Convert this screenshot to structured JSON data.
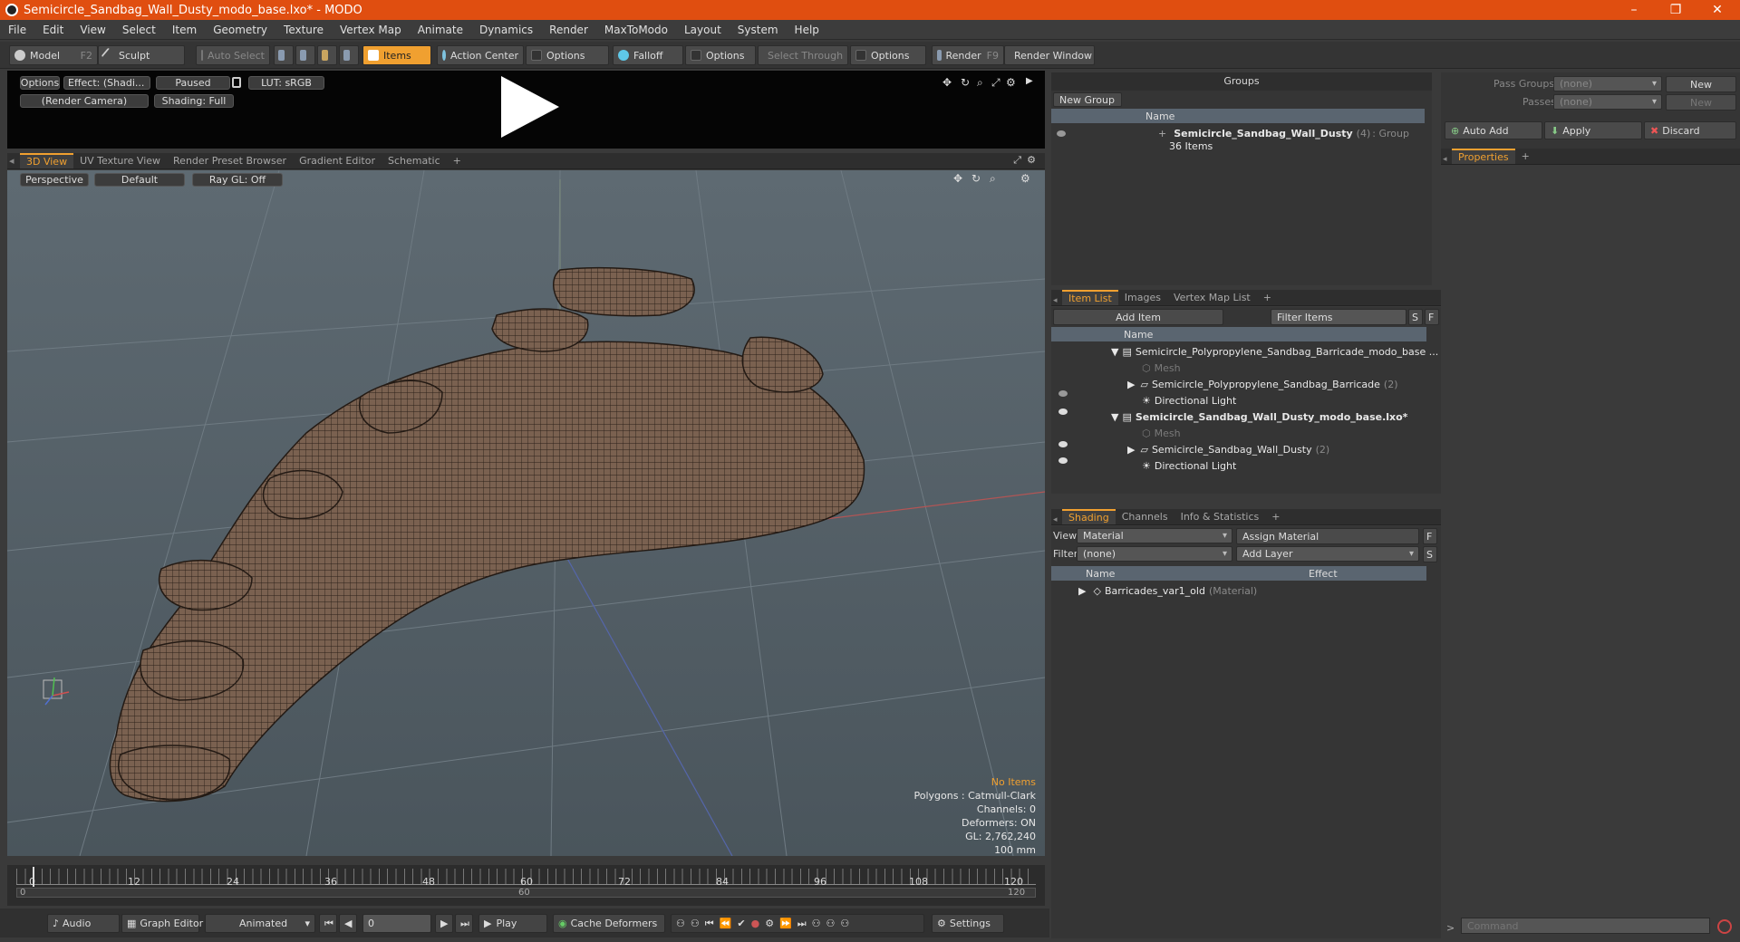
{
  "window": {
    "title": "Semicircle_Sandbag_Wall_Dusty_modo_base.lxo* - MODO",
    "minimize": "–",
    "maximize": "❐",
    "close": "✕"
  },
  "menu": [
    "File",
    "Edit",
    "View",
    "Select",
    "Item",
    "Geometry",
    "Texture",
    "Vertex Map",
    "Animate",
    "Dynamics",
    "Render",
    "MaxToModo",
    "Layout",
    "System",
    "Help"
  ],
  "toolbar": {
    "model": "Model",
    "model_key": "F2",
    "sculpt": "Sculpt",
    "auto_select": "Auto Select",
    "items": "Items",
    "action_center": "Action Center",
    "options1": "Options",
    "falloff": "Falloff",
    "options2": "Options",
    "select_through": "Select Through",
    "options3": "Options",
    "render": "Render",
    "render_key": "F9",
    "render_window": "Render Window"
  },
  "preview": {
    "options": "Options",
    "effect": "Effect: (Shadi...",
    "paused": "Paused",
    "lut": "LUT: sRGB",
    "camera": "(Render Camera)",
    "shading": "Shading: Full"
  },
  "view_tabs": [
    "3D View",
    "UV Texture View",
    "Render Preset Browser",
    "Gradient Editor",
    "Schematic",
    "+"
  ],
  "viewport": {
    "perspective": "Perspective",
    "default": "Default",
    "raygl": "Ray GL: Off",
    "no_items": "No Items",
    "polygons": "Polygons : Catmull-Clark",
    "channels": "Channels: 0",
    "deformers": "Deformers: ON",
    "gl": "GL: 2,762,240",
    "scale": "100 mm"
  },
  "timeline": {
    "ticks": [
      "0",
      "12",
      "24",
      "36",
      "48",
      "60",
      "72",
      "84",
      "96",
      "108",
      "120"
    ],
    "mid_label": "60",
    "start": "0",
    "end": "120",
    "end2": "120"
  },
  "bottom": {
    "audio": "Audio",
    "graph_editor": "Graph Editor",
    "animated": "Animated",
    "frame": "0",
    "play": "Play",
    "cache": "Cache Deformers",
    "settings": "Settings"
  },
  "groups": {
    "title": "Groups",
    "new_group": "New Group",
    "col_name": "Name",
    "item_name": "Semicircle_Sandbag_Wall_Dusty",
    "item_count": "(4)",
    "item_type": ": Group",
    "item_sub": "36 Items"
  },
  "right_top": {
    "pass_groups": "Pass Groups",
    "passes": "Passes",
    "none1": "(none)",
    "none2": "(none)",
    "new1": "New",
    "new2": "New",
    "auto_add": "Auto Add",
    "apply": "Apply",
    "discard": "Discard",
    "properties": "Properties",
    "plus": "+"
  },
  "itemlist": {
    "tabs": [
      "Item List",
      "Images",
      "Vertex Map List",
      "+"
    ],
    "add_item": "Add Item",
    "filter": "Filter Items",
    "s": "S",
    "f": "F",
    "col_name": "Name",
    "rows": [
      {
        "label": "Semicircle_Polypropylene_Sandbag_Barricade_modo_base ...",
        "count": "",
        "dim": false,
        "bold": false
      },
      {
        "label": "Mesh",
        "count": "",
        "dim": true,
        "bold": false
      },
      {
        "label": "Semicircle_Polypropylene_Sandbag_Barricade",
        "count": "(2)",
        "dim": false,
        "bold": false
      },
      {
        "label": "Directional Light",
        "count": "",
        "dim": false,
        "bold": false
      },
      {
        "label": "Semicircle_Sandbag_Wall_Dusty_modo_base.lxo*",
        "count": "",
        "dim": false,
        "bold": true
      },
      {
        "label": "Mesh",
        "count": "",
        "dim": true,
        "bold": false
      },
      {
        "label": "Semicircle_Sandbag_Wall_Dusty",
        "count": "(2)",
        "dim": false,
        "bold": false
      },
      {
        "label": "Directional Light",
        "count": "",
        "dim": false,
        "bold": false
      }
    ]
  },
  "shading": {
    "tabs": [
      "Shading",
      "Channels",
      "Info & Statistics",
      "+"
    ],
    "view_label": "View",
    "view_value": "Material",
    "assign": "Assign Material",
    "f": "F",
    "filter_label": "Filter",
    "filter_value": "(none)",
    "add_layer": "Add Layer",
    "s": "S",
    "col_name": "Name",
    "col_effect": "Effect",
    "mat_name": "Barricades_var1_old",
    "mat_type": "(Material)"
  },
  "command": {
    "placeholder": "Command",
    "arrow": ">"
  }
}
